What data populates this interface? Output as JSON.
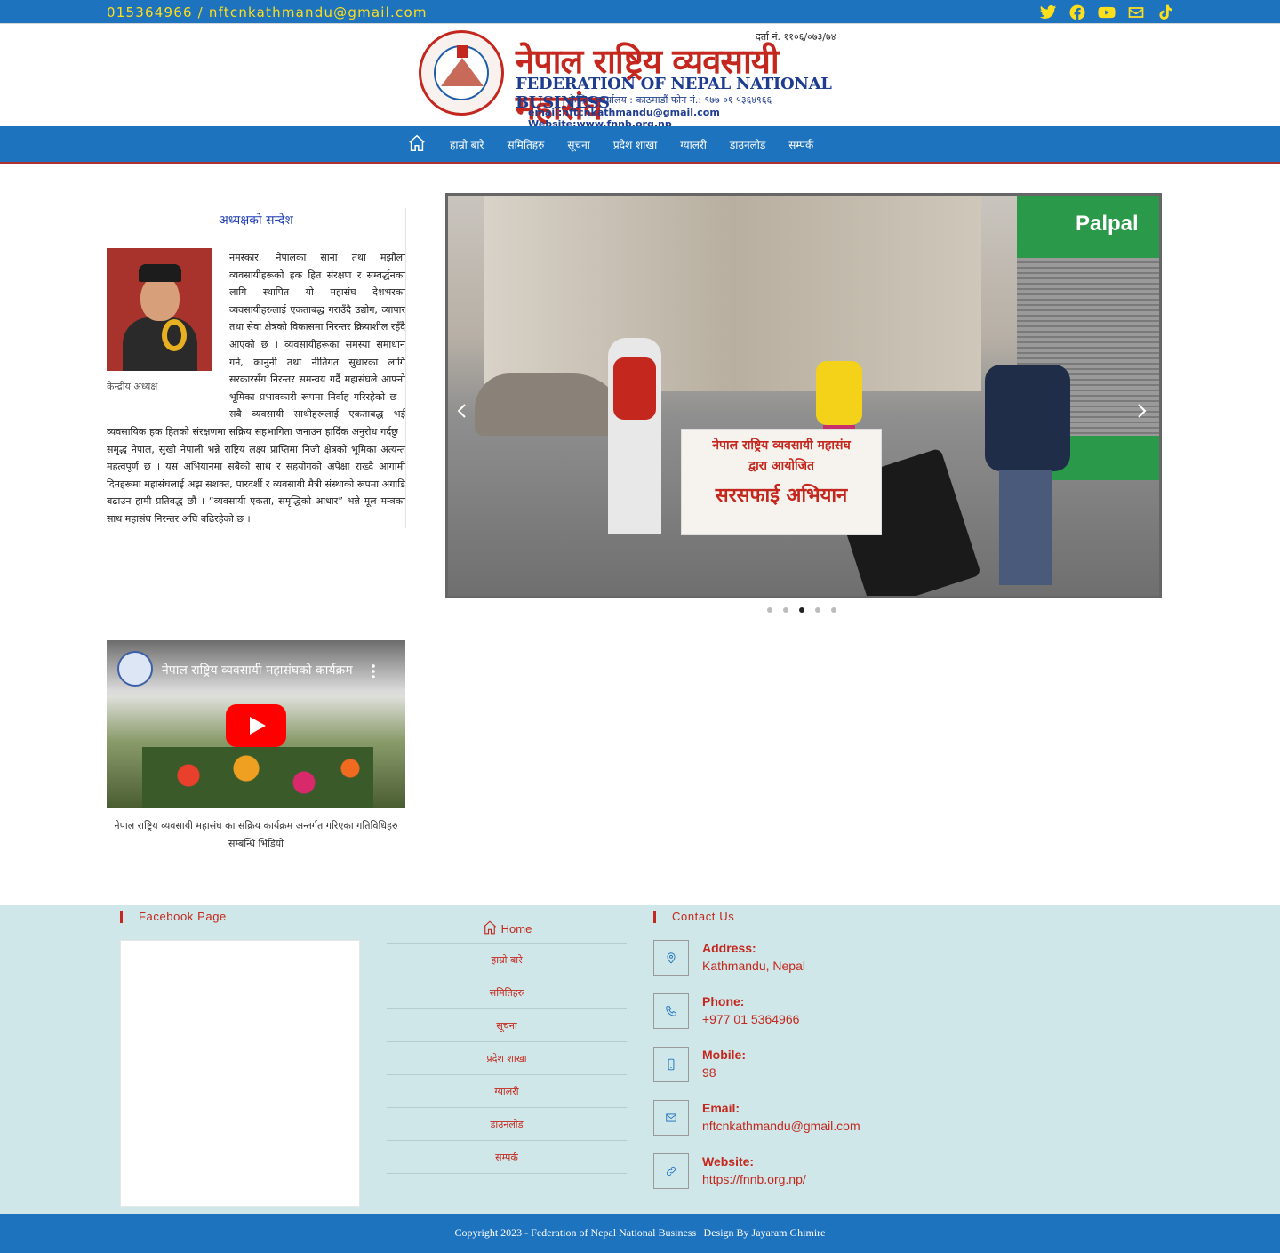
{
  "topbar": {
    "contact": "015364966 / nftcnkathmandu@gmail.com",
    "socials": [
      "twitter-icon",
      "facebook-icon",
      "youtube-icon",
      "mail-icon",
      "tiktok-icon"
    ],
    "color": "#ffdf1b"
  },
  "logo": {
    "nepali_title": "नेपाल राष्ट्रिय व्यवसायी महासंघ",
    "registration": "दर्ता नं. ११०६/०७३/७४",
    "english_title": "FEDERATION OF NEPAL NATIONAL BUSINESS",
    "office": "केन्द्रिय कार्यालय : काठमाडौं फोन नं.: ९७७ ०१ ५३६४९६६",
    "web": "email:nftcnkathmandu@gmail.com Website:www.fnnb.org.np"
  },
  "nav": {
    "items": [
      "हाम्रो बारे",
      "समितिहरु",
      "सूचना",
      "प्रदेश शाखा",
      "ग्यालरी",
      "डाउनलोड",
      "सम्पर्क"
    ]
  },
  "message": {
    "title": "अध्यक्षको सन्देश",
    "photo_caption": "केन्द्रीय अध्यक्ष",
    "body": "नमस्कार, नेपालका साना तथा मझौला व्यवसायीहरूको हक हित संरक्षण र सम्वर्द्धनका लागि स्थापित यो महासंघ देशभरका व्यवसायीहरुलाई एकताबद्ध गराउँदै उद्योग, व्यापार तथा सेवा क्षेत्रको विकासमा निरन्तर क्रियाशील रहँदै आएको छ । व्यवसायीहरूका समस्या समाधान गर्न, कानुनी तथा नीतिगत सुधारका लागि सरकारसँग निरन्तर समन्वय गर्दै महासंघले आफ्नो भूमिका प्रभावकारी रूपमा निर्वाह गरिरहेको छ । सबै व्यवसायी साथीहरूलाई एकताबद्ध भई व्यवसायिक हक हितको संरक्षणमा सक्रिय सहभागिता जनाउन हार्दिक अनुरोध गर्दछु । समृद्ध नेपाल, सुखी नेपाली भन्ने राष्ट्रिय लक्ष्य प्राप्तिमा निजी क्षेत्रको भूमिका अत्यन्त महत्वपूर्ण छ । यस अभियानमा सबैको साथ र सहयोगको अपेक्षा राख्दै आगामी दिनहरूमा महासंघलाई अझ सशक्त, पारदर्शी र व्यवसायी मैत्री संस्थाको रूपमा अगाडि बढाउन हामी प्रतिबद्ध छौं । “व्यवसायी एकता, समृद्धिको आधार” भन्ने मूल मन्त्रका साथ महासंघ निरन्तर अघि बढिरहेको छ ।"
  },
  "video": {
    "title": "नेपाल राष्ट्रिय व्यवसायी महासंघको कार्यक्रम",
    "caption": "नेपाल राष्ट्रिय व्यवसायी महासंघ का सक्रिय कार्यक्रम अन्तर्गत गरिएका गतिविधिहरु सम्बन्धि भिडियो"
  },
  "slider": {
    "banner_line1": "नेपाल राष्ट्रिय व्यवसायी महासंघ",
    "banner_line2": "द्वारा आयोजित",
    "banner_line3": "सरसफाई अभियान",
    "shop_sign": "Palpal",
    "slide_count": 5,
    "active_slide": 3
  },
  "footer": {
    "facebook_title": "Facebook Page",
    "contact_title": "Contact Us",
    "menu": [
      {
        "label": "Home",
        "icon": "home-icon"
      },
      {
        "label": "हाम्रो बारे"
      },
      {
        "label": "समितिहरु"
      },
      {
        "label": "सूचना"
      },
      {
        "label": "प्रदेश शाखा"
      },
      {
        "label": "ग्यालरी"
      },
      {
        "label": "डाउनलोड"
      },
      {
        "label": "सम्पर्क"
      }
    ],
    "contacts": [
      {
        "label": "Address:",
        "value": "Kathmandu, Nepal",
        "icon": "map-pin-icon"
      },
      {
        "label": "Phone:",
        "value": "+977 01 5364966",
        "icon": "phone-icon"
      },
      {
        "label": "Mobile:",
        "value": "98",
        "icon": "mobile-icon"
      },
      {
        "label": "Email:",
        "value": "nftcnkathmandu@gmail.com",
        "icon": "envelope-icon"
      },
      {
        "label": "Website:",
        "value": "https://fnnb.org.np/",
        "icon": "link-icon"
      }
    ]
  },
  "copyright": "Copyright 2023 - Federation of Nepal National Business | Design By Jayaram Ghimire",
  "colors": {
    "primary": "#1e73be",
    "accent": "#c4271d",
    "footer_bg": "#cfe7e8"
  }
}
